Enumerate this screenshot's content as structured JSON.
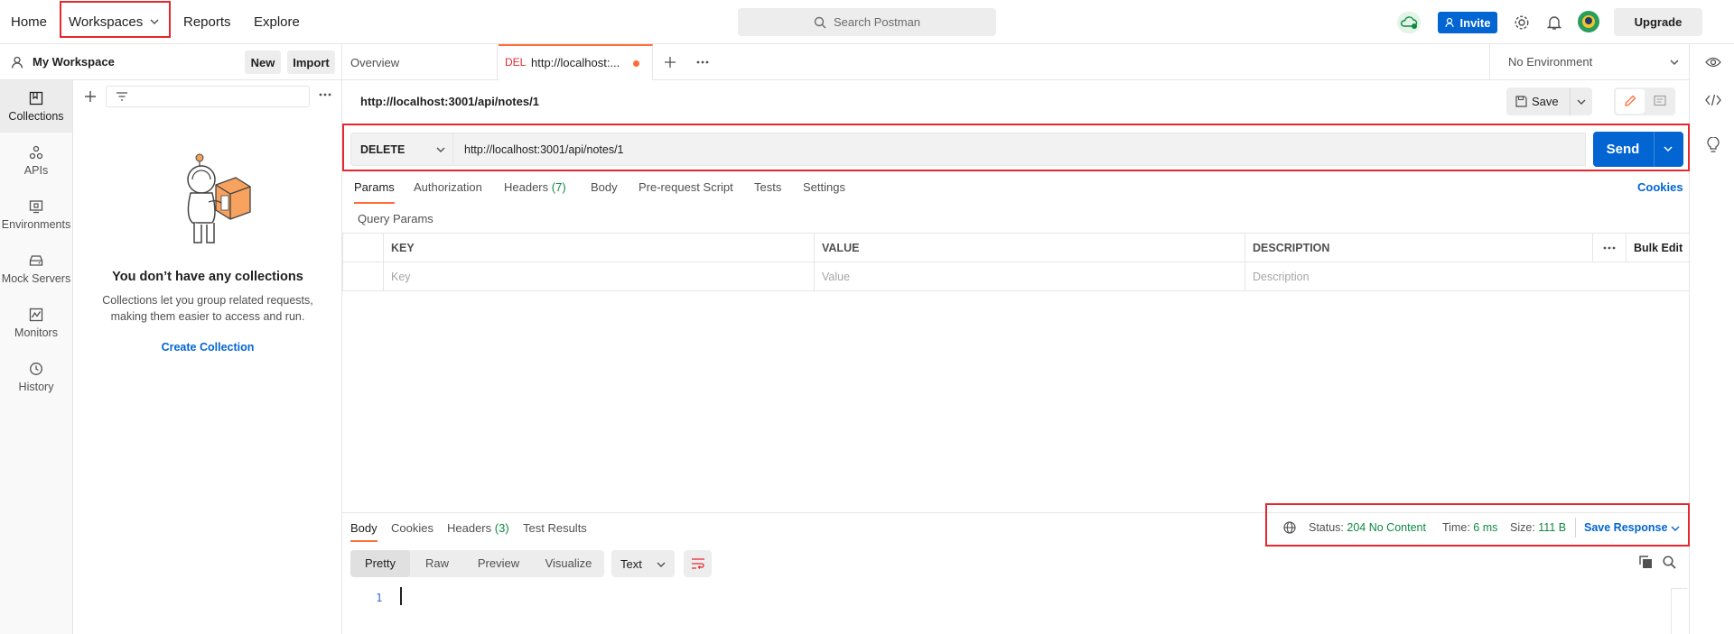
{
  "topnav": {
    "home": "Home",
    "workspaces": "Workspaces",
    "reports": "Reports",
    "explore": "Explore",
    "search_placeholder": "Search Postman",
    "invite": "Invite",
    "upgrade": "Upgrade"
  },
  "workspace": {
    "name": "My Workspace",
    "new_label": "New",
    "import_label": "Import"
  },
  "sidebar": {
    "items": [
      {
        "label": "Collections",
        "icon": "collections-icon"
      },
      {
        "label": "APIs",
        "icon": "apis-icon"
      },
      {
        "label": "Environments",
        "icon": "environments-icon"
      },
      {
        "label": "Mock Servers",
        "icon": "mock-servers-icon"
      },
      {
        "label": "Monitors",
        "icon": "monitors-icon"
      },
      {
        "label": "History",
        "icon": "history-icon"
      }
    ]
  },
  "collections": {
    "empty_title": "You don’t have any collections",
    "empty_line1": "Collections let you group related requests,",
    "empty_line2": "making them easier to access and run.",
    "create_label": "Create Collection"
  },
  "tabs": {
    "overview": "Overview",
    "active_method": "DEL",
    "active_title": "http://localhost:..."
  },
  "environment": {
    "selected": "No Environment"
  },
  "request": {
    "title": "http://localhost:3001/api/notes/1",
    "save_label": "Save",
    "method": "DELETE",
    "url": "http://localhost:3001/api/notes/1",
    "send_label": "Send",
    "tabs": {
      "params": "Params",
      "authorization": "Authorization",
      "headers": "Headers",
      "headers_count": "(7)",
      "body": "Body",
      "prerequest": "Pre-request Script",
      "tests": "Tests",
      "settings": "Settings",
      "cookies": "Cookies"
    },
    "query_params_label": "Query Params",
    "table": {
      "key_header": "KEY",
      "value_header": "VALUE",
      "description_header": "DESCRIPTION",
      "bulk_edit": "Bulk Edit",
      "key_placeholder": "Key",
      "value_placeholder": "Value",
      "description_placeholder": "Description"
    }
  },
  "response": {
    "tabs": {
      "body": "Body",
      "cookies": "Cookies",
      "headers": "Headers",
      "headers_count": "(3)",
      "test_results": "Test Results"
    },
    "status_label": "Status:",
    "status_value": "204 No Content",
    "time_label": "Time:",
    "time_value": "6 ms",
    "size_label": "Size:",
    "size_value": "111 B",
    "save_response": "Save Response",
    "view_modes": [
      "Pretty",
      "Raw",
      "Preview",
      "Visualize"
    ],
    "format": "Text",
    "line_number": "1"
  },
  "colors": {
    "accent_orange": "#ff6c37",
    "primary_blue": "#0265d2",
    "success_green": "#0d8a3f",
    "highlight_red": "#e8262e"
  }
}
